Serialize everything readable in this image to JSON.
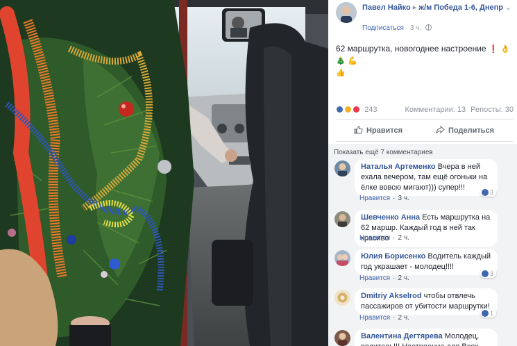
{
  "post": {
    "author": "Павел Найко",
    "location": "ж/м Победа 1-6, Днепр",
    "subscribe": "Подписаться",
    "time": "3 ч.",
    "text": "62 маршрутка, новогоднее настроение",
    "emojis": [
      "❗",
      "👌",
      "🎄",
      "💪",
      "👍"
    ]
  },
  "reactions": {
    "count": "243",
    "comments_label": "Комментарии: 13",
    "shares_label": "Репосты: 30"
  },
  "actions": {
    "like": "Нравится",
    "share": "Поделиться"
  },
  "comments_section": {
    "show_more": "Показать ещё 7 комментариев",
    "reply_label": "Нравится",
    "items": [
      {
        "author": "Наталья Артеменко",
        "text": "Вчера в ней ехала вечером, там ещё огоньки на ёлке вовсю мигают))) супер!!!",
        "time": "3 ч.",
        "likes": "3"
      },
      {
        "author": "Шевченко Анна",
        "text": "Есть маршрутка на 62 маршр. Каждый год в ней так красиво",
        "time": "2 ч.",
        "likes": ""
      },
      {
        "author": "Юлия Борисенко",
        "text": "Водитель каждый год украшает - молодец!!!!",
        "time": "2 ч.",
        "likes": "3"
      },
      {
        "author": "Dmitriy Akselrod",
        "text": "чтобы отвлечь пассажиров от убитости маршрутки!",
        "time": "2 ч.",
        "likes": "1"
      },
      {
        "author": "Валентина Дегтярева",
        "text": "Молодец, водитель!!! Настроение для Всех",
        "time": "",
        "likes": ""
      }
    ]
  },
  "colors": {
    "link": "#365899",
    "accent": "#4267b2",
    "muted": "#90949c",
    "comment_bg": "#f2f3f5"
  }
}
